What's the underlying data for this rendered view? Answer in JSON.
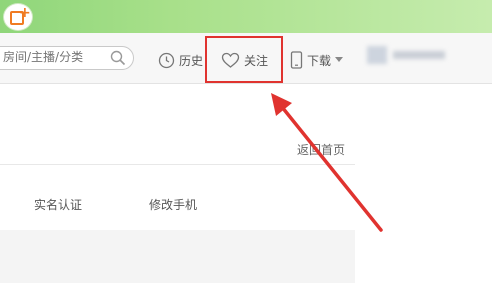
{
  "search": {
    "placeholder": "房间/主播/分类"
  },
  "nav": {
    "history_label": "历史",
    "follow_label": "关注",
    "download_label": "下载"
  },
  "content": {
    "back_home": "返回首页",
    "tabs": [
      {
        "label": "实名认证"
      },
      {
        "label": "修改手机"
      }
    ]
  },
  "colors": {
    "highlight": "#e0332f",
    "brand": "#f07b22",
    "topbar": "#a8e08a"
  }
}
